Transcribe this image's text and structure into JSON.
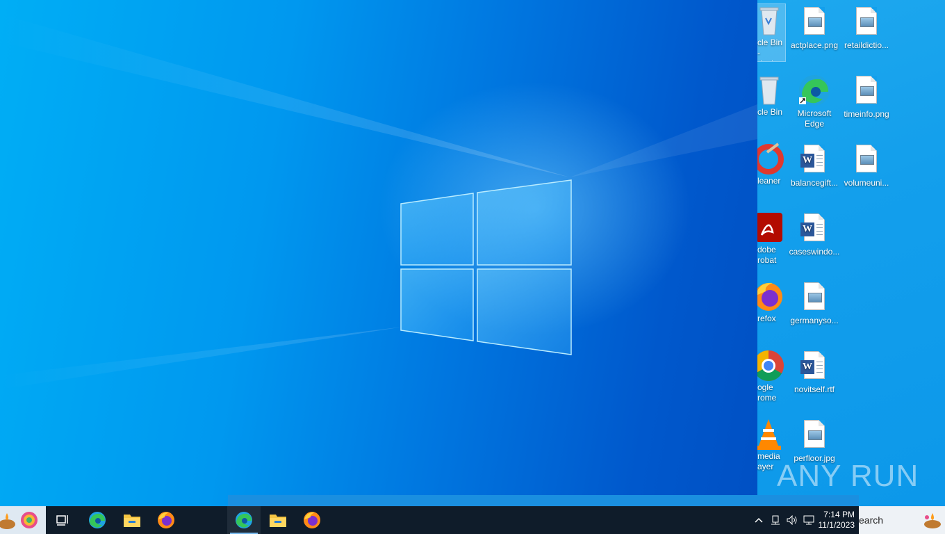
{
  "desktop": {
    "icons": [
      {
        "label_l1": "cle Bin -",
        "label_l2": "rtcut",
        "icon": "recycle-bin-icon"
      },
      {
        "label_l1": "cle Bin",
        "label_l2": "",
        "icon": "recycle-bin-icon"
      },
      {
        "label_l1": "leaner",
        "label_l2": "",
        "icon": "ccleaner-icon"
      },
      {
        "label_l1": "dobe",
        "label_l2": "robat",
        "icon": "adobe-acrobat-icon"
      },
      {
        "label_l1": "refox",
        "label_l2": "",
        "icon": "firefox-icon"
      },
      {
        "label_l1": "ogle",
        "label_l2": "rome",
        "icon": "chrome-icon"
      },
      {
        "label_l1": "media",
        "label_l2": "ayer",
        "icon": "vlc-icon"
      },
      {
        "label_l1": "actplace.png",
        "label_l2": "",
        "icon": "image-file-icon"
      },
      {
        "label_l1": "Microsoft",
        "label_l2": "Edge",
        "icon": "edge-icon"
      },
      {
        "label_l1": "balancegift...",
        "label_l2": "",
        "icon": "word-file-icon"
      },
      {
        "label_l1": "caseswindo...",
        "label_l2": "",
        "icon": "word-file-icon"
      },
      {
        "label_l1": "germanyso...",
        "label_l2": "",
        "icon": "image-file-icon"
      },
      {
        "label_l1": "novitself.rtf",
        "label_l2": "",
        "icon": "word-file-icon"
      },
      {
        "label_l1": "perfloor.jpg",
        "label_l2": "",
        "icon": "image-file-icon"
      },
      {
        "label_l1": "retaildictio...",
        "label_l2": "",
        "icon": "image-file-icon"
      },
      {
        "label_l1": "timeinfo.png",
        "label_l2": "",
        "icon": "image-file-icon"
      },
      {
        "label_l1": "volumeuni...",
        "label_l2": "",
        "icon": "image-file-icon"
      }
    ]
  },
  "watermark": "ANY RUN",
  "taskbar": {
    "clock_time": "7:14 PM",
    "clock_date": "11/1/2023",
    "search_text": "earch"
  },
  "colors": {
    "taskbar": "#0f1c2a",
    "accent": "#76b9ed",
    "wallpaper": "#0098ef"
  }
}
